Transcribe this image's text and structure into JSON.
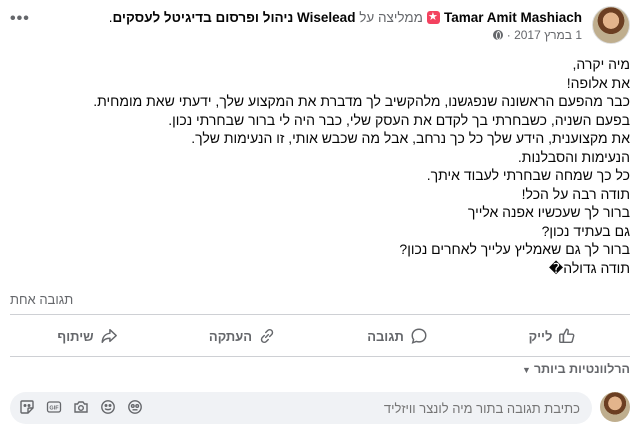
{
  "post": {
    "author": "Tamar Amit Mashiach",
    "verb": "ממליצה על",
    "page_name": "Wiselead ניהול ופרסום בדיגיטל לעסקים",
    "dot": ".",
    "date": "1 במרץ 2017 ·",
    "more": "•••",
    "lines": [
      "מיה יקרה,",
      "את אלופה!",
      "כבר מהפעם הראשונה שנפגשנו, מלהקשיב לך מדברת את המקצוע שלך, ידעתי שאת מומחית.",
      "בפעם השניה, כשבחרתי בך לקדם את העסק שלי, כבר היה לי ברור שבחרתי נכון.",
      "את מקצוענית, הידע שלך כל כך נרחב, אבל מה שכבש אותי, זו הנעימות שלך.",
      "הנעימות והסבלנות.",
      "כל כך שמחה שבחרתי לעבוד איתך.",
      "תודה רבה על הכל!",
      "ברור לך שעכשיו אפנה אלייך",
      "גם בעתיד נכון?",
      "ברור לך גם שאמליץ עלייך לאחרים נכון?",
      "תודה גדולה�"
    ],
    "comments_count": "תגובה אחת"
  },
  "actions": {
    "like": "לייק",
    "comment": "תגובה",
    "copy": "העתקה",
    "share": "שיתוף"
  },
  "relevance": "הרלוונטיות ביותר",
  "composer": {
    "placeholder": "כתיבת תגובה בתור מיה לונצר וויזליד",
    "icons": [
      "sticker-icon",
      "gif-icon",
      "camera-icon",
      "emoji-icon",
      "avatar-sticker-icon"
    ]
  },
  "colors": {
    "text": "#050505",
    "secondary": "#65676b",
    "recommend": "#f3425f",
    "composer_bg": "#f0f2f5"
  }
}
